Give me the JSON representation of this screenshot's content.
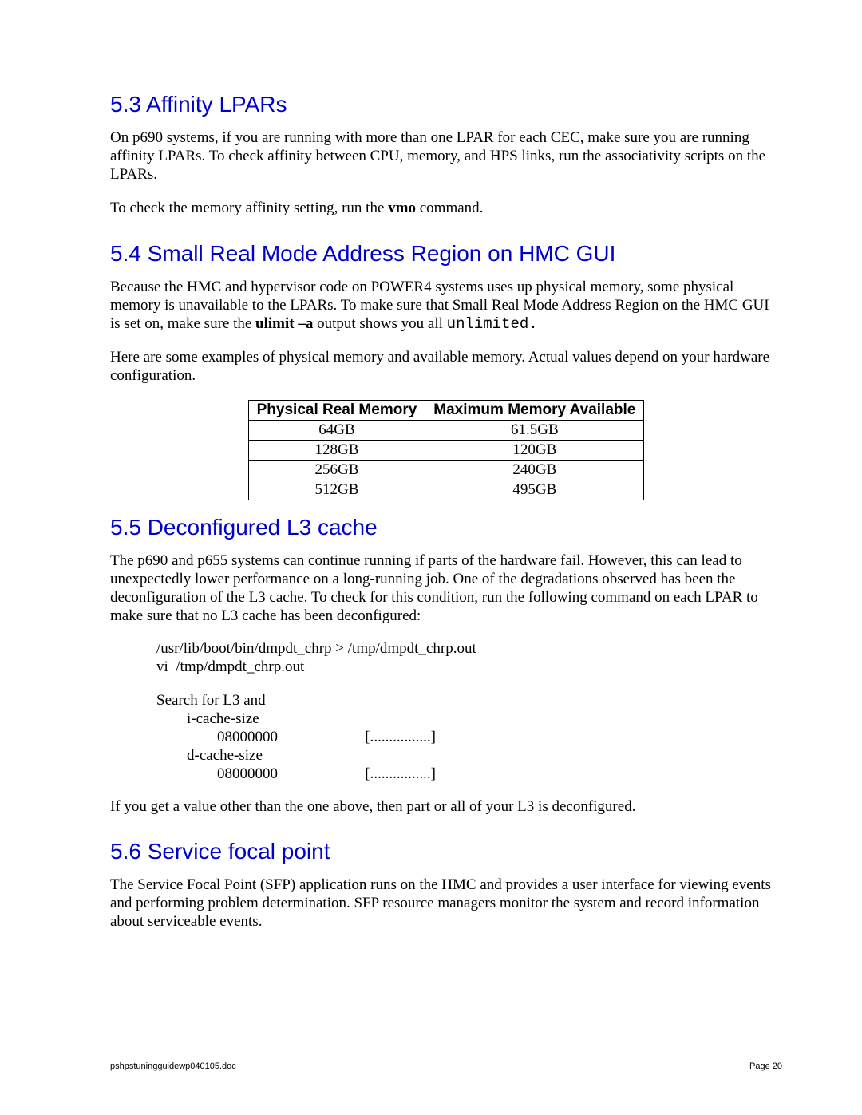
{
  "sec53": {
    "title": "5.3 Affinity LPARs",
    "p1": "On p690 systems, if you are running with more than one LPAR for each CEC, make sure you are running affinity LPARs.  To check affinity between CPU, memory, and HPS links, run the associativity scripts on the LPARs.",
    "p2_pre": "To check the memory affinity setting, run the ",
    "p2_bold": "vmo",
    "p2_post": " command."
  },
  "sec54": {
    "title": "5.4 Small Real Mode Address Region on HMC GUI",
    "p1_pre": "Because the HMC and hypervisor code on POWER4 systems uses up physical memory, some physical memory is unavailable to the LPARs.  To make sure that Small Real Mode Address Region on the HMC GUI is set on, make sure the ",
    "p1_bold": "ulimit –a",
    "p1_mid": " output shows you all ",
    "p1_mono": "unlimited.",
    "p2": "Here are some examples of physical memory and available memory.  Actual values depend on your hardware configuration.",
    "table": {
      "headers": [
        "Physical Real Memory",
        "Maximum Memory Available"
      ],
      "rows": [
        [
          "64GB",
          "61.5GB"
        ],
        [
          "128GB",
          "120GB"
        ],
        [
          "256GB",
          "240GB"
        ],
        [
          "512GB",
          "495GB"
        ]
      ]
    }
  },
  "sec55": {
    "title": "5.5 Deconfigured L3 cache",
    "p1": "The p690 and p655 systems can continue running if parts of the hardware fail. However, this can lead to unexpectedly lower performance on a long-running job.  One of the degradations observed has been the deconfiguration of the L3 cache.  To check for this condition, run the following command on each LPAR to make sure that no L3 cache has been deconfigured:",
    "code": {
      "l1": "/usr/lib/boot/bin/dmpdt_chrp > /tmp/dmpdt_chrp.out",
      "l2": "vi  /tmp/dmpdt_chrp.out",
      "l3": "Search for L3 and",
      "l4": "        i-cache-size",
      "l5": "                08000000                       [................]",
      "l6": "        d-cache-size",
      "l7": "                08000000                       [................]"
    },
    "p2": "If you get a value other than the one above, then part or all of your L3 is deconfigured."
  },
  "sec56": {
    "title": "5.6 Service focal point",
    "p1": "The Service Focal Point (SFP) application runs on the HMC and provides a user interface for viewing events and performing problem determination.  SFP resource managers monitor the system and record information about serviceable events."
  },
  "footer": {
    "file": "pshpstuningguidewp040105.doc",
    "page": "Page 20"
  }
}
